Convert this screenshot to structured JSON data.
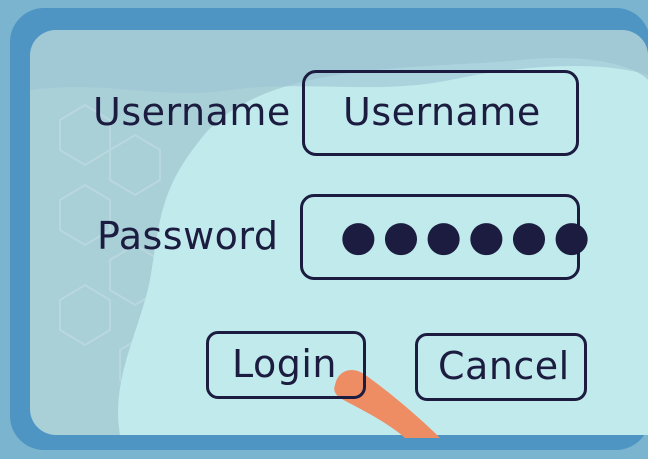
{
  "form": {
    "username_label": "Username",
    "username_value": "Username",
    "password_label": "Password",
    "password_value": "●●●●●●",
    "login_label": "Login",
    "cancel_label": "Cancel"
  },
  "colors": {
    "frame": "#4f95c4",
    "panel": "#bfe9ea",
    "panel_left": "#a6cfd6",
    "ink": "#1b1c3f",
    "finger": "#ee8c63"
  },
  "icons": {
    "pointer": "finger-pointer-icon"
  }
}
